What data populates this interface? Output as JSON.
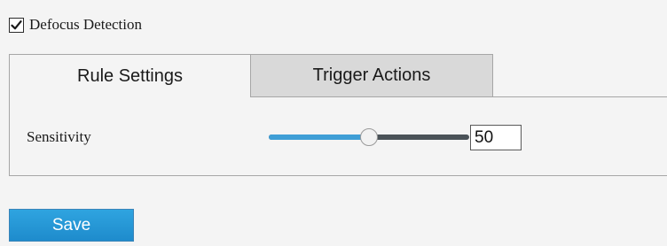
{
  "enable": {
    "label": "Defocus Detection",
    "checked": true,
    "check_icon": "checkmark-icon"
  },
  "tabs": [
    {
      "label": "Rule Settings",
      "active": true
    },
    {
      "label": "Trigger Actions",
      "active": false
    }
  ],
  "rule_settings": {
    "sensitivity_label": "Sensitivity",
    "sensitivity_value": "50",
    "slider_min": 0,
    "slider_max": 100,
    "slider_value": 50
  },
  "footer": {
    "save_label": "Save"
  },
  "colors": {
    "accent": "#2b9bd8",
    "slider_fill": "#3f9ed6",
    "slider_track": "#4a5258",
    "inactive_tab": "#d9d9d9",
    "page_background": "#f4f4f4"
  }
}
